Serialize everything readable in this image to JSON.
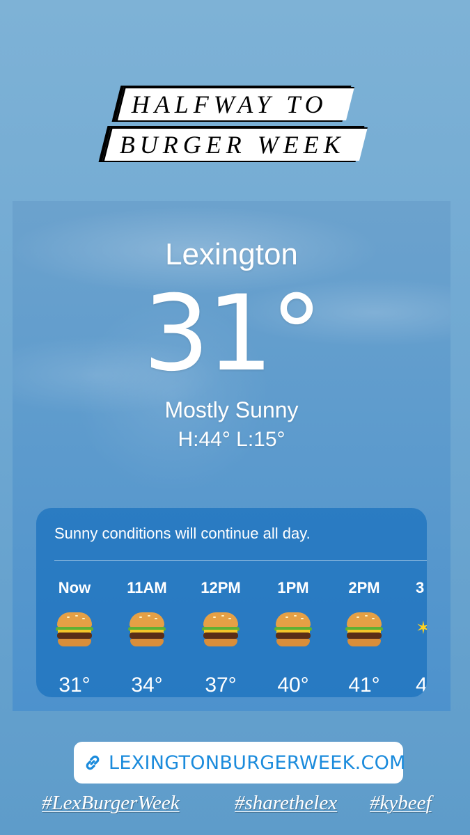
{
  "banner": {
    "line1": "HALFWAY TO",
    "line2": "BURGER WEEK"
  },
  "weather": {
    "city": "Lexington",
    "temperature": "31°",
    "condition": "Mostly Sunny",
    "hilo": "H:44°  L:15°",
    "summary": "Sunny conditions will continue all day.",
    "hours": [
      {
        "label": "Now",
        "icon": "burger-icon",
        "temp": "31°"
      },
      {
        "label": "11AM",
        "icon": "burger-icon",
        "temp": "34°"
      },
      {
        "label": "12PM",
        "icon": "burger-icon",
        "temp": "37°"
      },
      {
        "label": "1PM",
        "icon": "burger-icon",
        "temp": "40°"
      },
      {
        "label": "2PM",
        "icon": "burger-icon",
        "temp": "41°"
      },
      {
        "label": "3",
        "icon": "sun-icon",
        "temp": "4"
      }
    ]
  },
  "link": {
    "icon": "link-icon",
    "text": "LEXINGTONBURGERWEEK.COM"
  },
  "hashtags": [
    "#LexBurgerWeek",
    "#sharethelex",
    "#kybeef"
  ]
}
